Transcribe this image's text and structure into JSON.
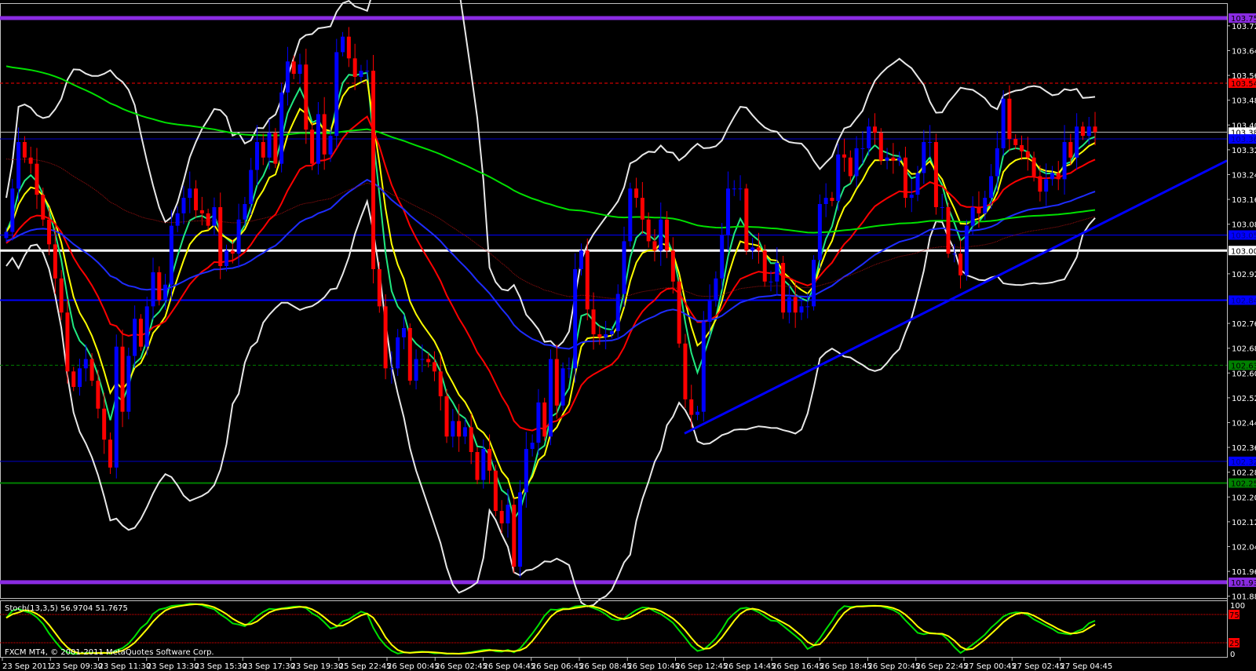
{
  "chart_data": {
    "type": "candlestick",
    "platform_caption": "FXCM MT4, © 2001-2011 MetaQuotes Software Corp.",
    "ylim": [
      101.86,
      103.81
    ],
    "price_ticks": [
      "103.725",
      "103.645",
      "103.565",
      "103.485",
      "103.405",
      "103.325",
      "103.245",
      "103.165",
      "103.085",
      "102.925",
      "102.765",
      "102.685",
      "102.605",
      "102.525",
      "102.445",
      "102.365",
      "102.285",
      "102.205",
      "102.125",
      "102.045",
      "101.965",
      "101.885"
    ],
    "time_labels": [
      "23 Sep 2011",
      "23 Sep 09:30",
      "23 Sep 11:30",
      "23 Sep 13:30",
      "23 Sep 15:30",
      "23 Sep 17:30",
      "23 Sep 19:30",
      "25 Sep 22:45",
      "26 Sep 00:45",
      "26 Sep 02:45",
      "26 Sep 04:45",
      "26 Sep 06:45",
      "26 Sep 08:45",
      "26 Sep 10:45",
      "26 Sep 12:45",
      "26 Sep 14:45",
      "26 Sep 16:45",
      "26 Sep 18:45",
      "26 Sep 20:45",
      "26 Sep 22:45",
      "27 Sep 00:45",
      "27 Sep 02:45",
      "27 Sep 04:45"
    ],
    "closes": [
      103.06,
      103.2,
      103.35,
      103.3,
      103.28,
      103.18,
      103.1,
      103.02,
      102.91,
      102.8,
      102.61,
      102.56,
      102.62,
      102.65,
      102.58,
      102.49,
      102.39,
      102.3,
      102.69,
      102.48,
      102.66,
      102.78,
      102.69,
      102.82,
      102.93,
      102.84,
      102.89,
      103.08,
      103.12,
      103.17,
      103.2,
      103.13,
      103.12,
      103.08,
      103.14,
      102.95,
      103.0,
      102.99,
      103.1,
      103.15,
      103.26,
      103.35,
      103.3,
      103.38,
      103.28,
      103.51,
      103.61,
      103.57,
      103.6,
      103.39,
      103.28,
      103.44,
      103.31,
      103.37,
      103.64,
      103.69,
      103.62,
      103.56,
      103.58,
      103.58,
      102.94,
      102.82,
      102.62,
      102.62,
      102.72,
      102.75,
      102.58,
      102.65,
      102.65,
      102.64,
      102.61,
      102.53,
      102.4,
      102.45,
      102.4,
      102.43,
      102.35,
      102.26,
      102.36,
      102.29,
      102.16,
      102.12,
      102.18,
      101.98,
      102.22,
      102.36,
      102.38,
      102.51,
      102.4,
      102.65,
      102.5,
      102.62,
      102.62,
      102.94,
      103.0,
      102.81,
      102.73,
      102.72,
      102.73,
      102.74,
      102.86,
      103.03,
      103.2,
      103.17,
      103.1,
      103.03,
      103.0,
      103.1,
      103.0,
      102.9,
      102.7,
      102.52,
      102.47,
      102.48,
      102.77,
      102.84,
      102.91,
      103.05,
      103.2,
      103.2,
      103.2,
      103.0,
      103.01,
      103.0,
      102.9,
      102.9,
      102.96,
      102.8,
      102.85,
      102.8,
      102.82,
      102.82,
      102.97,
      103.15,
      103.17,
      103.16,
      103.31,
      103.3,
      103.24,
      103.33,
      103.33,
      103.4,
      103.38,
      103.29,
      103.3,
      103.29,
      103.3,
      103.17,
      103.18,
      103.25,
      103.35,
      103.35,
      103.14,
      103.14,
      102.99,
      102.99,
      102.92,
      103.08,
      103.14,
      103.12,
      103.17,
      103.24,
      103.33,
      103.49,
      103.36,
      103.34,
      103.32,
      103.3,
      103.24,
      103.19,
      103.23,
      103.25,
      103.23,
      103.35,
      103.3,
      103.4,
      103.37,
      103.4,
      103.382
    ],
    "horizontal_levels": [
      {
        "price": 103.75,
        "label": "103.750",
        "color": "#8a2be2",
        "style": "thick"
      },
      {
        "price": 103.54,
        "label": "103.540",
        "color": "#ff0000",
        "style": "dashed"
      },
      {
        "price": 103.382,
        "label": "103.382",
        "color": "#c0c0c0",
        "style": "bid"
      },
      {
        "price": 103.36,
        "label": "103.360",
        "color": "#0000c8",
        "style": "thin"
      },
      {
        "price": 103.05,
        "label": "103.050",
        "color": "#0000ff",
        "style": "thin"
      },
      {
        "price": 103.0,
        "label": "103.000",
        "color": "#ffffff",
        "style": "thick"
      },
      {
        "price": 102.84,
        "label": "102.840",
        "color": "#0000ff",
        "style": "medium"
      },
      {
        "price": 102.63,
        "label": "102.630",
        "color": "#008000",
        "style": "dashed"
      },
      {
        "price": 102.32,
        "label": "102.320",
        "color": "#0000c8",
        "style": "thin"
      },
      {
        "price": 102.25,
        "label": "102.250",
        "color": "#008000",
        "style": "medium"
      },
      {
        "price": 101.93,
        "label": "101.930",
        "color": "#8a2be2",
        "style": "thick"
      }
    ],
    "trendline": {
      "from_price": 102.41,
      "to_price": 103.29,
      "color": "#0000ff"
    },
    "indicators": {
      "ema": [
        {
          "period": 5,
          "color": "#20e880",
          "seed": 103.06
        },
        {
          "period": 8,
          "color": "#ffff00",
          "seed": 103.06
        },
        {
          "period": 21,
          "color": "#ff0000",
          "seed": 103.02
        },
        {
          "period": 55,
          "color": "#1e2cff",
          "seed": 103.03
        },
        {
          "period": 100,
          "color": "#a01010",
          "seed": 103.3,
          "dotted": true
        },
        {
          "period": 200,
          "color": "#00e000",
          "seed": 103.6
        }
      ],
      "bollinger": {
        "period": 20,
        "deviation": 2.2,
        "color": "#e8e8e8"
      }
    },
    "stochastic": {
      "label": "Stoch(13,3,5) 56.9704 51.7675",
      "k_period": 13,
      "d_period": 3,
      "slowing": 5,
      "levels": [
        "75",
        "25"
      ],
      "scale": [
        "100",
        "0"
      ],
      "main_color": "#00e000",
      "signal_color": "#ffff00"
    },
    "colors": {
      "bull": "#0000ff",
      "bear": "#ff0000",
      "background": "#000000",
      "grid": "#c0c0c0"
    }
  }
}
